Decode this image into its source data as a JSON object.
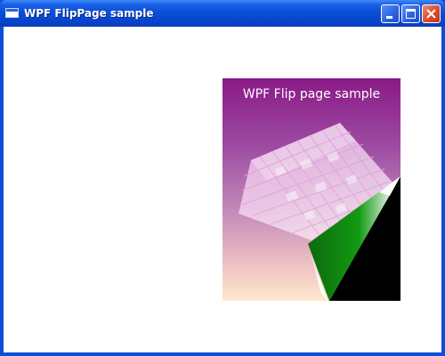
{
  "window": {
    "title": "WPF FlipPage sample"
  },
  "controls": {
    "minimize_icon": "minimize-icon",
    "maximize_icon": "maximize-icon",
    "close_icon": "close-icon"
  },
  "page": {
    "title": "WPF Flip page sample",
    "top_color": "#8a1a86",
    "bottom_color": "#fde8cc",
    "flip_color": "#118a11"
  }
}
